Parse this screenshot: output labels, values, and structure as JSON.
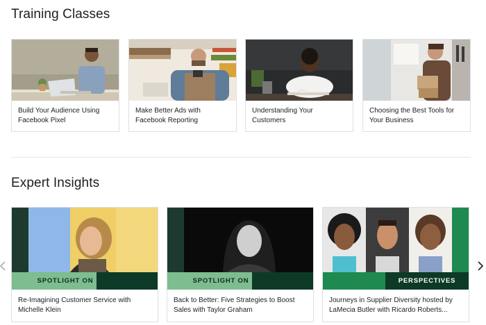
{
  "training": {
    "title": "Training Classes",
    "cards": [
      {
        "caption": "Build Your Audience Using Facebook Pixel",
        "image": "man-with-laptop-photo"
      },
      {
        "caption": "Make Better Ads with Facebook Reporting",
        "image": "shop-owner-with-phone-photo"
      },
      {
        "caption": "Understanding Your Customers",
        "image": "woman-at-cafe-table-photo"
      },
      {
        "caption": "Choosing the Best Tools for Your Business",
        "image": "woman-holding-boxes-photo"
      }
    ]
  },
  "expert": {
    "title": "Expert Insights",
    "cards": [
      {
        "badge": "SPOTLIGHT ON",
        "caption": "Re-Imagining Customer Service with Michelle Klein",
        "image": "speaker-on-stage-photo"
      },
      {
        "badge": "SPOTLIGHT ON",
        "caption": "Back to Better: Five Strategies to Boost Sales with Taylor Graham",
        "image": "woman-black-and-white-portrait-photo"
      },
      {
        "badge": "PERSPECTIVES",
        "caption": "Journeys in Supplier Diversity hosted by LaMecia Butler with Ricardo Roberts...",
        "image": "three-people-portraits-photo"
      }
    ]
  },
  "carousel": {
    "prev_icon": "chevron-left-icon",
    "next_icon": "chevron-right-icon"
  },
  "colors": {
    "badge_light": "#7dbd8f",
    "badge_dark": "#0d3a26",
    "accent_green": "#1e8a4f"
  }
}
